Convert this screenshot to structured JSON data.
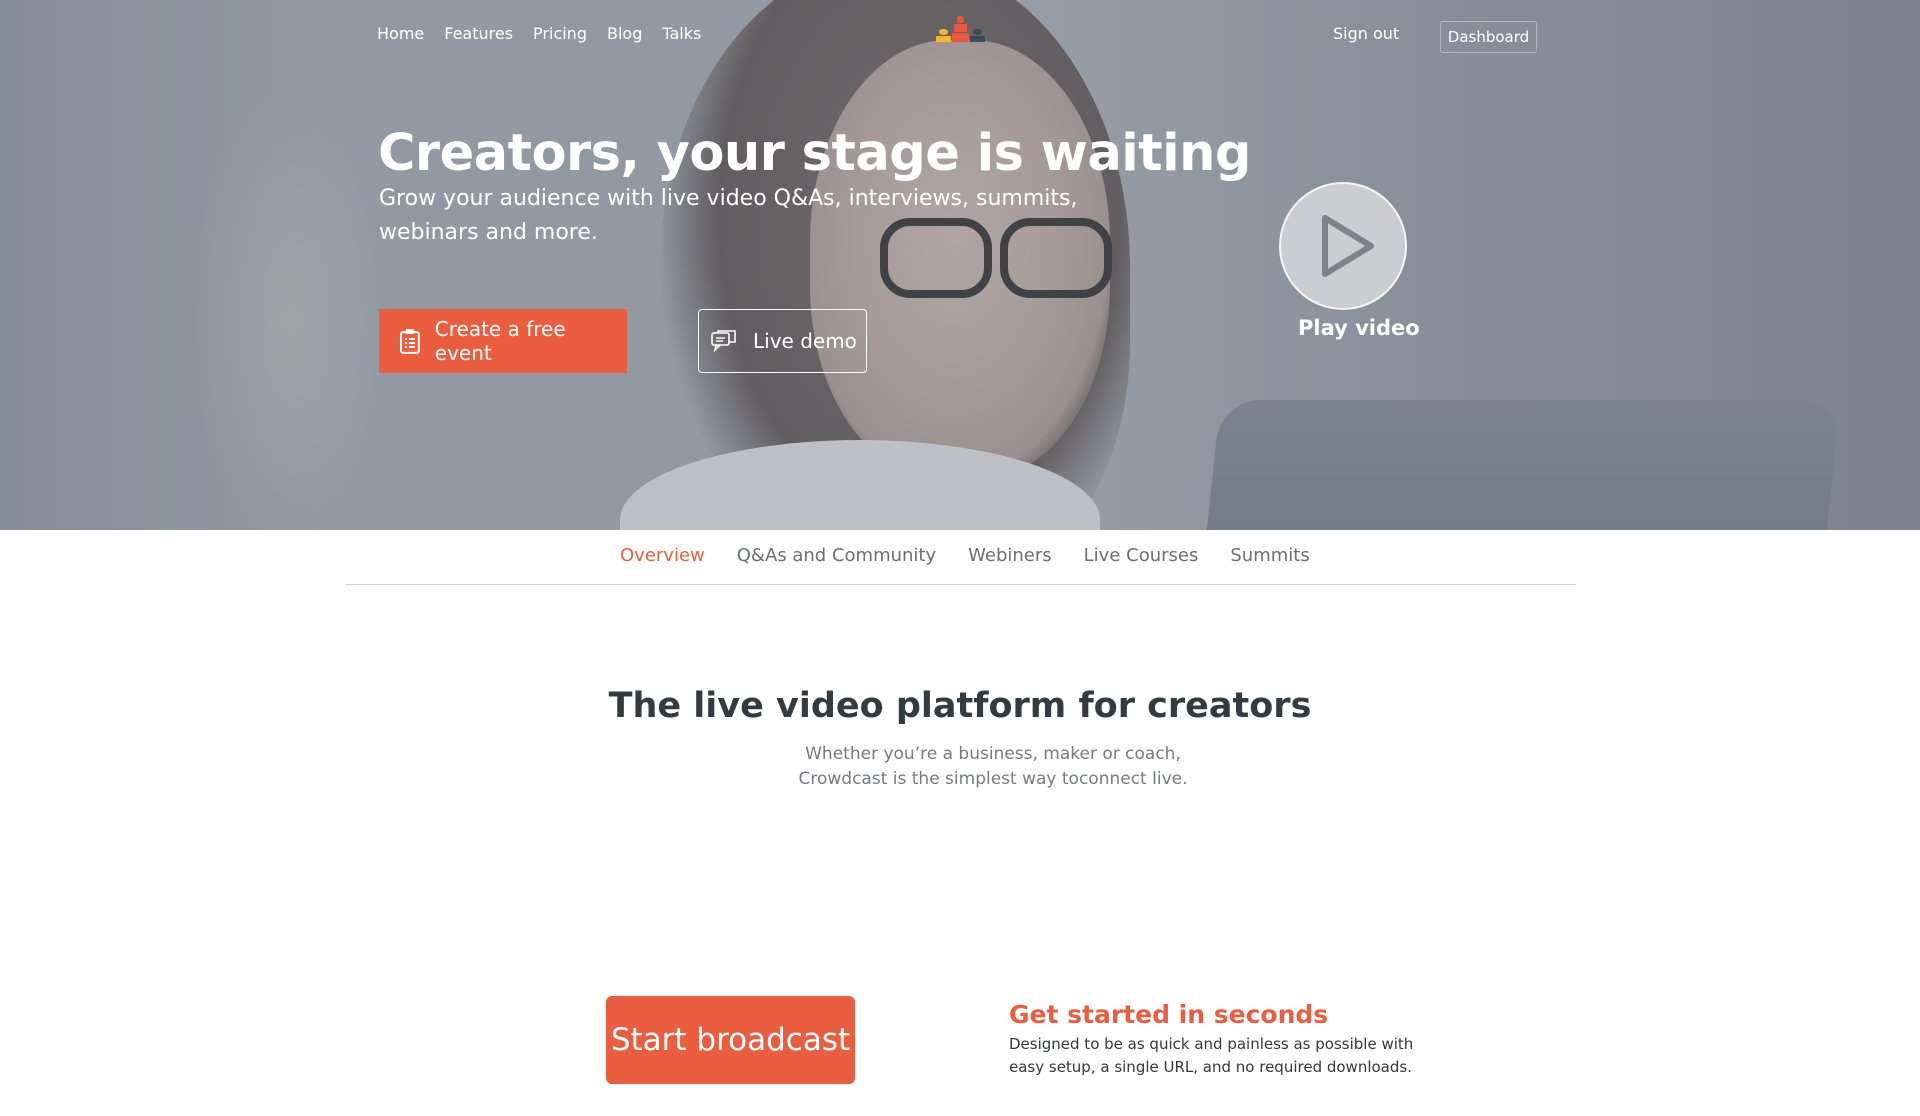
{
  "nav": {
    "links": [
      "Home",
      "Features",
      "Pricing",
      "Blog",
      "Talks"
    ],
    "sign_out": "Sign out",
    "dashboard": "Dashboard"
  },
  "hero": {
    "title": "Creators, your stage is waiting",
    "subtitle": "Grow your audience with live video Q&As, interviews, summits, webinars and more.",
    "create_event": "Create a free event",
    "live_demo": "Live demo",
    "play_video": "Play video"
  },
  "tabs": {
    "items": [
      "Overview",
      "Q&As and Community",
      "Webiners",
      "Live Courses",
      "Summits"
    ],
    "active": "Overview"
  },
  "platform": {
    "title": "The live video platform for creators",
    "line1": "Whether you’re a business, maker or coach,",
    "line2": "Crowdcast is the simplest way toconnect live."
  },
  "get_started": {
    "button": "Start broadcast",
    "title": "Get started in seconds",
    "text": "Designed to be as quick and painless as possible with easy setup, a single URL, and no required downloads."
  },
  "colors": {
    "accent": "#eb5d3f",
    "logo_yellow": "#f3b72a",
    "logo_red": "#e8583c",
    "logo_dark": "#3b4a5a"
  },
  "icons": [
    "clipboard-icon",
    "chat-bubbles-icon",
    "play-icon",
    "crowdcast-logo"
  ]
}
